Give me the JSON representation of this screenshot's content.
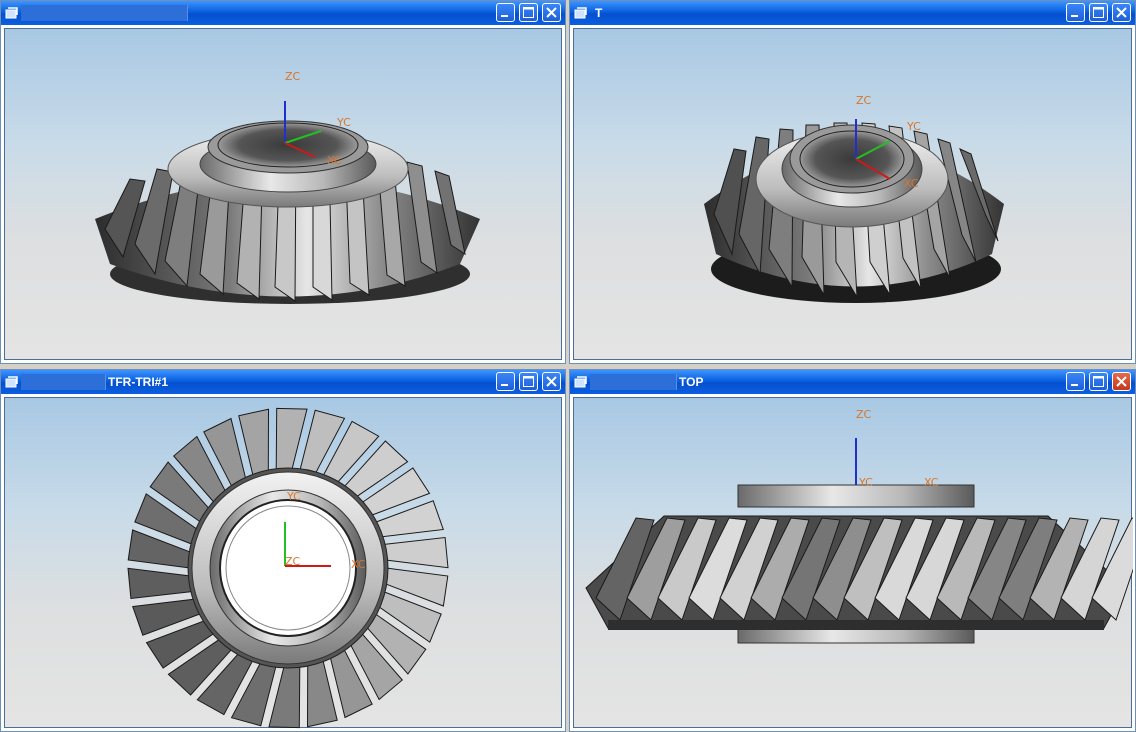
{
  "viewports": [
    {
      "title": "",
      "title_field": true,
      "close_highlight": false,
      "axes": {
        "zc": "ZC",
        "yc": "YC",
        "xc": "XC"
      }
    },
    {
      "title": "T",
      "title_field": false,
      "close_highlight": false,
      "axes": {
        "zc": "ZC",
        "yc": "YC",
        "xc": "XC"
      }
    },
    {
      "title": "TFR-TRI#1",
      "title_field": true,
      "close_highlight": false,
      "axes": {
        "zc": "ZC",
        "yc": "YC",
        "xc": "XC"
      }
    },
    {
      "title": "TOP",
      "title_field": true,
      "close_highlight": true,
      "axes": {
        "zc": "ZC",
        "yc": "YC",
        "xc": "XC"
      }
    }
  ],
  "window_buttons": {
    "minimize": "minimize-icon",
    "maximize": "maximize-icon",
    "close": "close-icon"
  },
  "colors": {
    "titlebar": "#0a5fde",
    "axis_z": "#1f2fd0",
    "axis_y": "#22c022",
    "axis_x": "#d01818",
    "axis_label": "#d8762b",
    "gear_dark": "#3a3a3a",
    "gear_light": "#d8d8d8"
  }
}
